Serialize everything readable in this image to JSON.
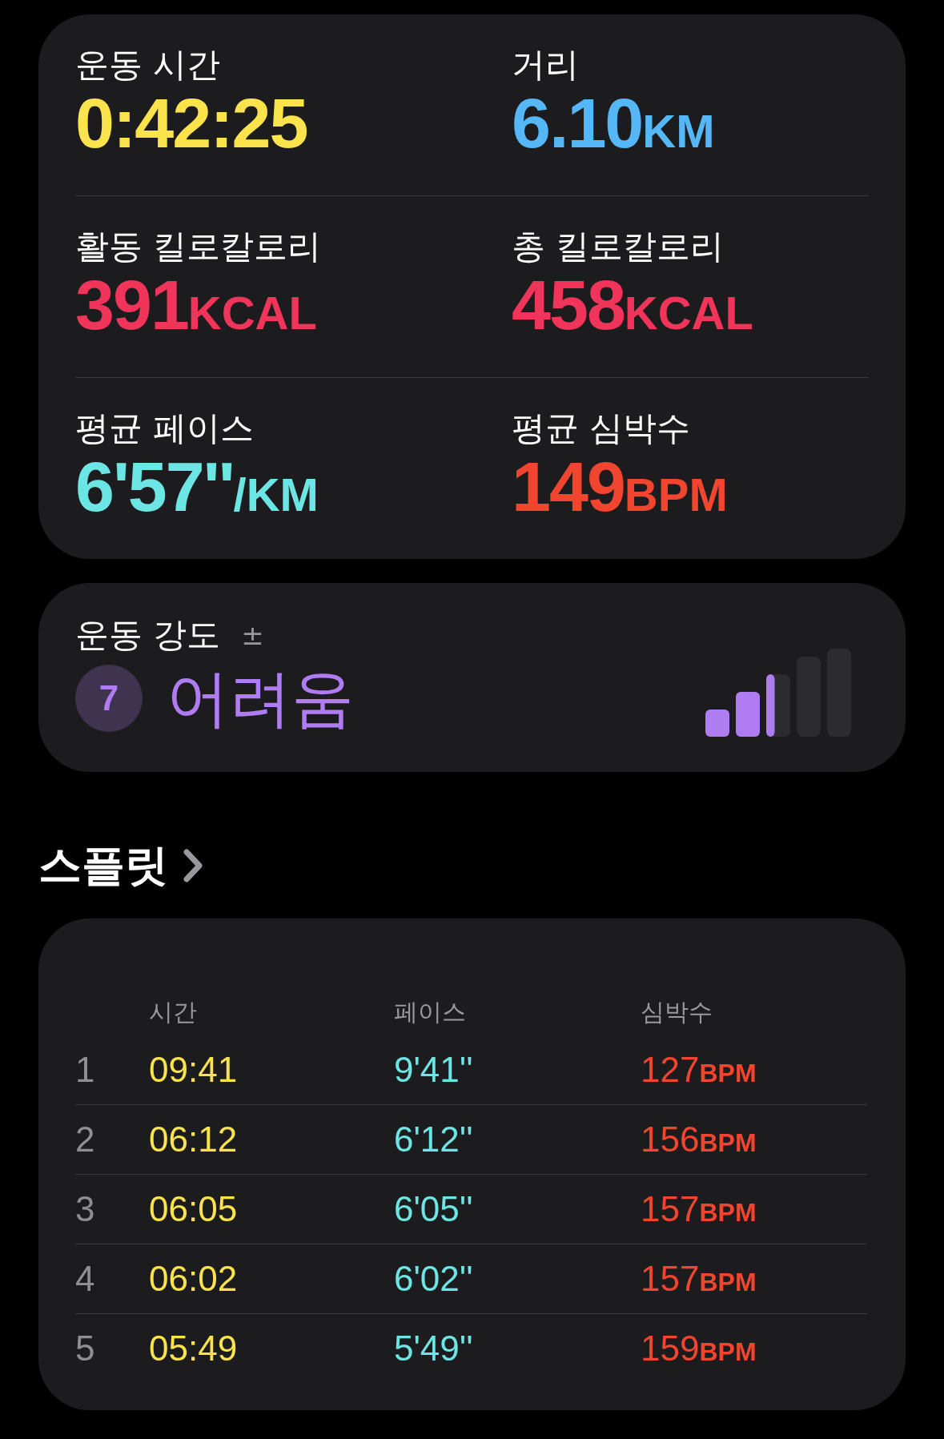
{
  "metrics": [
    {
      "label": "운동 시간",
      "value": "0:42:25",
      "color": "#fbe34b"
    },
    {
      "label": "거리",
      "value": "6.10",
      "unit": "KM",
      "color": "#56b7f7"
    },
    {
      "label": "활동 킬로칼로리",
      "value": "391",
      "unit": "KCAL",
      "color": "#f0345a"
    },
    {
      "label": "총 킬로칼로리",
      "value": "458",
      "unit": "KCAL",
      "color": "#f0345a"
    },
    {
      "label": "평균 페이스",
      "value": "6'57''",
      "unit": "/KM",
      "color": "#6ce6e4"
    },
    {
      "label": "평균 심박수",
      "value": "149",
      "unit": "BPM",
      "color": "#f1452f"
    }
  ],
  "effort": {
    "label": "운동 강도",
    "adjust": "±",
    "score": "7",
    "rating": "어려움"
  },
  "splits": {
    "title": "스플릿",
    "columns": [
      "시간",
      "페이스",
      "심박수"
    ],
    "rows": [
      {
        "index": "1",
        "time": "09:41",
        "pace": "9'41''",
        "heart_rate": "127",
        "unit": "BPM"
      },
      {
        "index": "2",
        "time": "06:12",
        "pace": "6'12''",
        "heart_rate": "156",
        "unit": "BPM"
      },
      {
        "index": "3",
        "time": "06:05",
        "pace": "6'05''",
        "heart_rate": "157",
        "unit": "BPM"
      },
      {
        "index": "4",
        "time": "06:02",
        "pace": "6'02''",
        "heart_rate": "157",
        "unit": "BPM"
      },
      {
        "index": "5",
        "time": "05:49",
        "pace": "5'49''",
        "heart_rate": "159",
        "unit": "BPM"
      }
    ]
  }
}
